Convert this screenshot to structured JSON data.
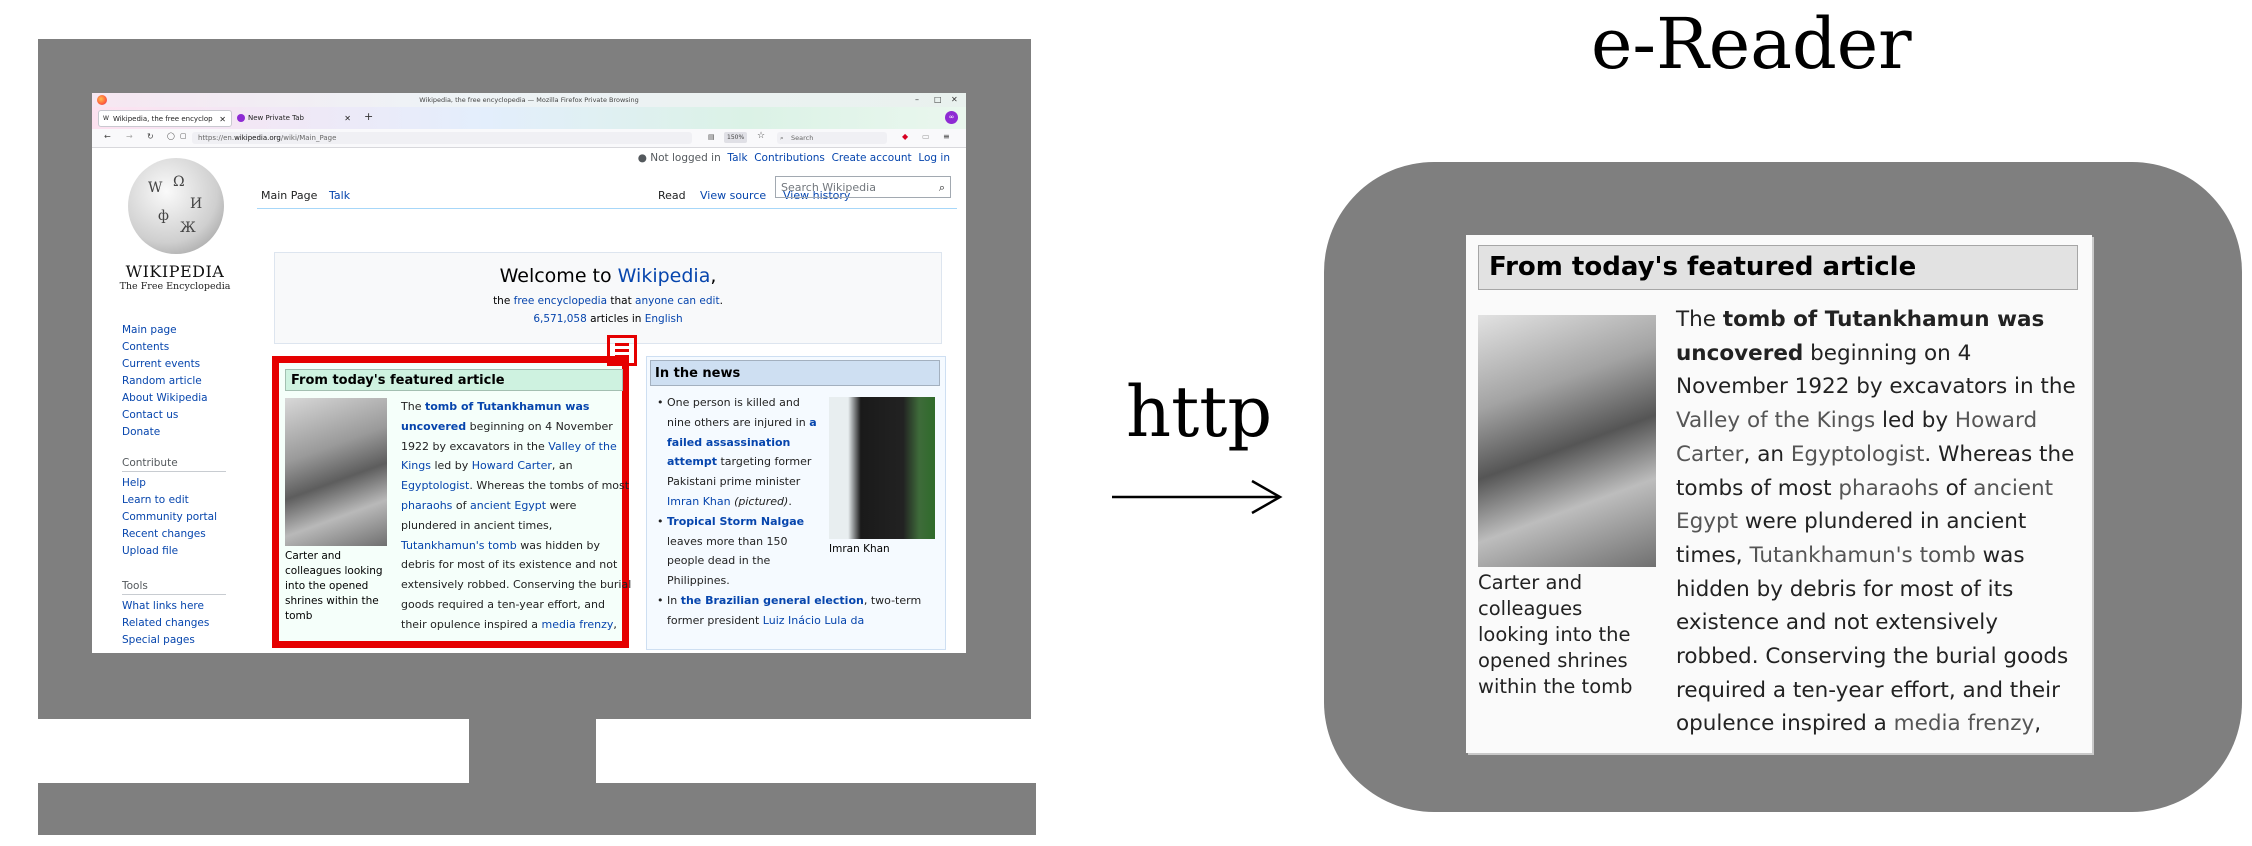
{
  "browser": {
    "window_title": "Wikipedia, the free encyclopedia — Mozilla Firefox Private Browsing",
    "tabs": [
      {
        "label": "Wikipedia, the free encyclop"
      },
      {
        "label": "New Private Tab"
      }
    ],
    "url_prefix": "https://en.",
    "url_domain": "wikipedia.org",
    "url_path": "/wiki/Main_Page",
    "zoom": "150%",
    "search_placeholder": "Search"
  },
  "wiki": {
    "wordmark": "WIKIPEDIA",
    "tagline": "The Free Encyclopedia",
    "main_nav": [
      "Main page",
      "Contents",
      "Current events",
      "Random article",
      "About Wikipedia",
      "Contact us",
      "Donate"
    ],
    "contribute_heading": "Contribute",
    "contribute_nav": [
      "Help",
      "Learn to edit",
      "Community portal",
      "Recent changes",
      "Upload file"
    ],
    "tools_heading": "Tools",
    "tools_nav": [
      "What links here",
      "Related changes",
      "Special pages"
    ],
    "personal": {
      "not_logged_in": "Not logged in",
      "talk": "Talk",
      "contributions": "Contributions",
      "create_account": "Create account",
      "log_in": "Log in"
    },
    "tabs": {
      "main_page": "Main Page",
      "talk": "Talk",
      "read": "Read",
      "view_source": "View source",
      "view_history": "View history"
    },
    "search_placeholder": "Search Wikipedia",
    "welcome": {
      "prefix": "Welcome to ",
      "link": "Wikipedia",
      "suffix": ",",
      "sub_a": "the ",
      "sub_link1": "free encyclopedia",
      "sub_b": " that ",
      "sub_link2": "anyone can edit",
      "sub_c": ".",
      "count_link": "6,571,058",
      "count_text": " articles in ",
      "count_lang": "English"
    },
    "tfa": {
      "heading": "From today's featured article",
      "caption": "Carter and colleagues looking into the opened shrines within the tomb",
      "text": {
        "a": "The ",
        "b_bold": "tomb of Tutankhamun was uncovered",
        "c": " beginning on 4 November 1922 by excavators in the ",
        "d_link": "Valley of the Kings",
        "e": " led by ",
        "f_link": "Howard Carter",
        "g": ", an ",
        "h_link": "Egyptologist",
        "i": ". Whereas the tombs of most ",
        "j_link": "pharaohs",
        "k": " of ",
        "l_link": "ancient Egypt",
        "m": " were plundered in ancient times, ",
        "n_link": "Tutankhamun's tomb",
        "o": " was hidden by debris for most of its existence and not extensively robbed. Conserving the burial goods required a ten-year effort, and their opulence inspired a ",
        "p_link": "media frenzy",
        "q": ","
      }
    },
    "news": {
      "heading": "In the news",
      "image_caption": "Imran Khan",
      "item1": {
        "a": "One person is killed and nine others are injured in ",
        "b_link": "a failed assassination attempt",
        "c": " targeting former Pakistani prime minister ",
        "d_link": "Imran Khan",
        "e": " ",
        "f_ital": "(pictured)",
        "g": "."
      },
      "item2": {
        "a_link": "Tropical Storm Nalgae",
        "b": " leaves more than 150 people dead in the Philippines."
      },
      "item3": {
        "a": "In ",
        "b_link": "the Brazilian general election",
        "c": ", two-term former president ",
        "d_link": "Luiz Inácio Lula da"
      }
    }
  },
  "diagram": {
    "arrow_label": "http",
    "ereader_title": "e-Reader"
  }
}
